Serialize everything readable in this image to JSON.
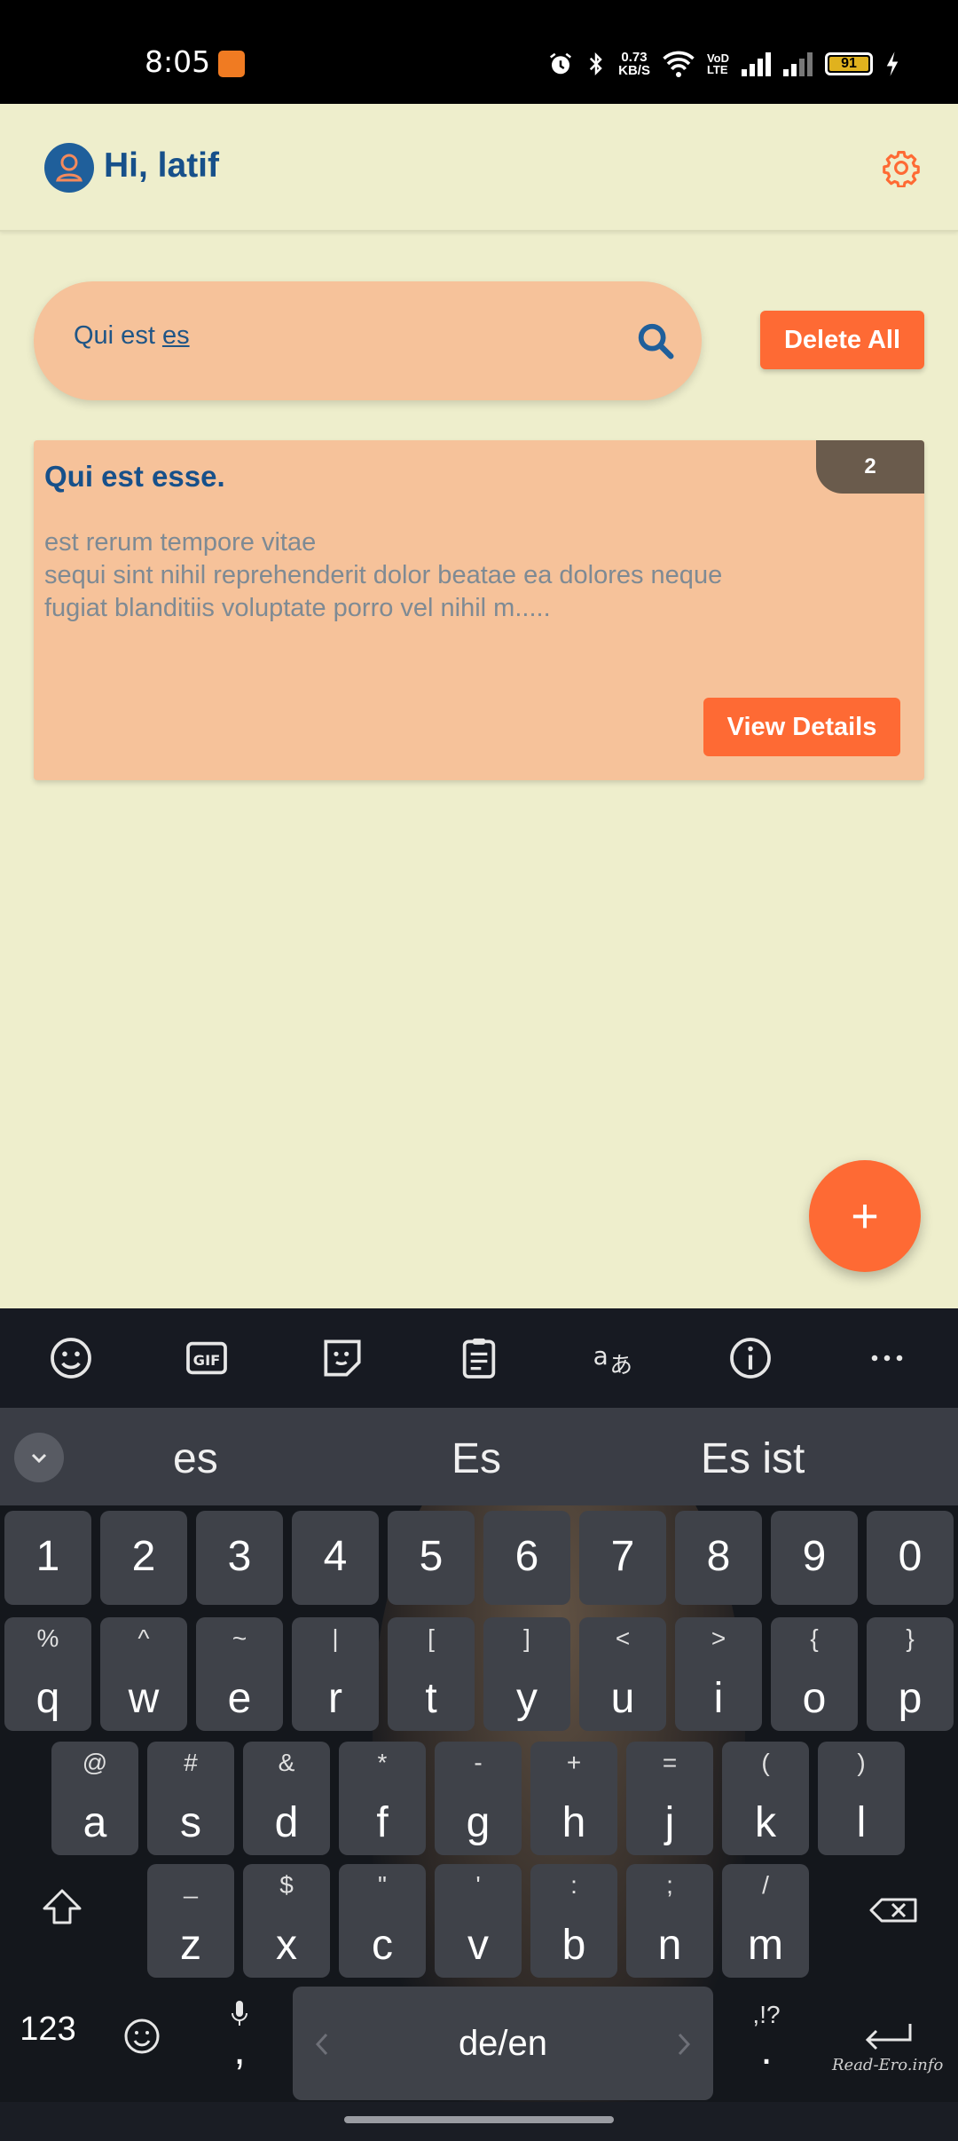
{
  "status_bar": {
    "time": "8:05",
    "net_speed_value": "0.73",
    "net_speed_unit": "KB/S",
    "volte": "VoLTE",
    "battery": "91"
  },
  "header": {
    "greeting": "Hi, latif"
  },
  "search": {
    "value_prefix": "Qui est ",
    "value_underlined": "es"
  },
  "toolbar": {
    "delete_all_label": "Delete All"
  },
  "post_card": {
    "title": "Qui est esse.",
    "badge": "2",
    "body": "est rerum tempore vitae\nsequi sint nihil reprehenderit dolor beatae ea dolores neque\nfugiat blanditiis voluptate porro vel nihil m.....",
    "view_details_label": "View Details"
  },
  "fab": {
    "label": "+"
  },
  "keyboard": {
    "suggestions": [
      "es",
      "Es",
      "Es ist"
    ],
    "number_row": [
      "1",
      "2",
      "3",
      "4",
      "5",
      "6",
      "7",
      "8",
      "9",
      "0"
    ],
    "row1": [
      {
        "main": "q",
        "sub": "%"
      },
      {
        "main": "w",
        "sub": "^"
      },
      {
        "main": "e",
        "sub": "~"
      },
      {
        "main": "r",
        "sub": "|"
      },
      {
        "main": "t",
        "sub": "["
      },
      {
        "main": "y",
        "sub": "]"
      },
      {
        "main": "u",
        "sub": "<"
      },
      {
        "main": "i",
        "sub": ">"
      },
      {
        "main": "o",
        "sub": "{"
      },
      {
        "main": "p",
        "sub": "}"
      }
    ],
    "row2": [
      {
        "main": "a",
        "sub": "@"
      },
      {
        "main": "s",
        "sub": "#"
      },
      {
        "main": "d",
        "sub": "&"
      },
      {
        "main": "f",
        "sub": "*"
      },
      {
        "main": "g",
        "sub": "-"
      },
      {
        "main": "h",
        "sub": "+"
      },
      {
        "main": "j",
        "sub": "="
      },
      {
        "main": "k",
        "sub": "("
      },
      {
        "main": "l",
        "sub": ")"
      }
    ],
    "row3": [
      {
        "main": "z",
        "sub": "_"
      },
      {
        "main": "x",
        "sub": "$"
      },
      {
        "main": "c",
        "sub": "\""
      },
      {
        "main": "v",
        "sub": "'"
      },
      {
        "main": "b",
        "sub": ":"
      },
      {
        "main": "n",
        "sub": ";"
      },
      {
        "main": "m",
        "sub": "/"
      }
    ],
    "num_switch": "123",
    "comma_main": ",",
    "space_label": "de/en",
    "period_main": ".",
    "period_sub": ",!?",
    "watermark": "Read-Ero.info"
  }
}
